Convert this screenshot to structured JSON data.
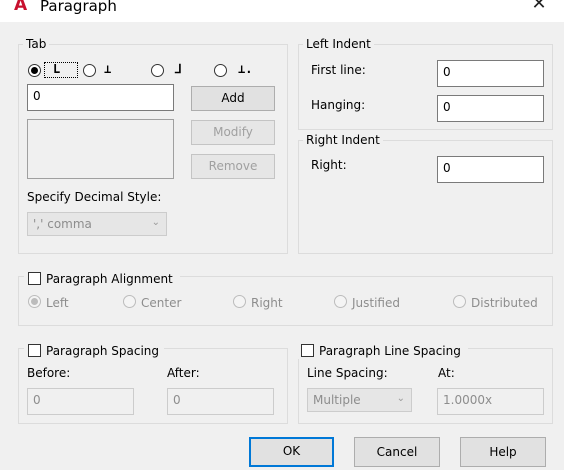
{
  "window": {
    "title": "Paragraph",
    "app_icon": "A",
    "close_glyph": "✕"
  },
  "tab": {
    "group_label": "Tab",
    "tab_types": [
      {
        "name": "left-tab",
        "glyph": "L",
        "selected": true
      },
      {
        "name": "center-tab",
        "glyph": "⊥",
        "selected": false
      },
      {
        "name": "right-tab",
        "glyph": "⅃",
        "selected": false
      },
      {
        "name": "decimal-tab",
        "glyph": "⊥.",
        "selected": false
      }
    ],
    "position_value": "0",
    "add_label": "Add",
    "modify_label": "Modify",
    "remove_label": "Remove",
    "decimal_style_label": "Specify Decimal Style:",
    "decimal_style_value": "',' comma"
  },
  "left_indent": {
    "group_label": "Left Indent",
    "first_line_label": "First line:",
    "first_line_value": "0",
    "hanging_label": "Hanging:",
    "hanging_value": "0"
  },
  "right_indent": {
    "group_label": "Right Indent",
    "right_label": "Right:",
    "right_value": "0"
  },
  "alignment": {
    "checkbox_label": "Paragraph Alignment",
    "checked": false,
    "options": [
      "Left",
      "Center",
      "Right",
      "Justified",
      "Distributed"
    ],
    "selected": "Left"
  },
  "spacing": {
    "checkbox_label": "Paragraph Spacing",
    "checked": false,
    "before_label": "Before:",
    "before_value": "0",
    "after_label": "After:",
    "after_value": "0"
  },
  "line_spacing": {
    "checkbox_label": "Paragraph Line Spacing",
    "checked": false,
    "line_spacing_label": "Line Spacing:",
    "line_spacing_value": "Multiple",
    "at_label": "At:",
    "at_value": "1.0000x"
  },
  "footer": {
    "ok_label": "OK",
    "cancel_label": "Cancel",
    "help_label": "Help"
  }
}
